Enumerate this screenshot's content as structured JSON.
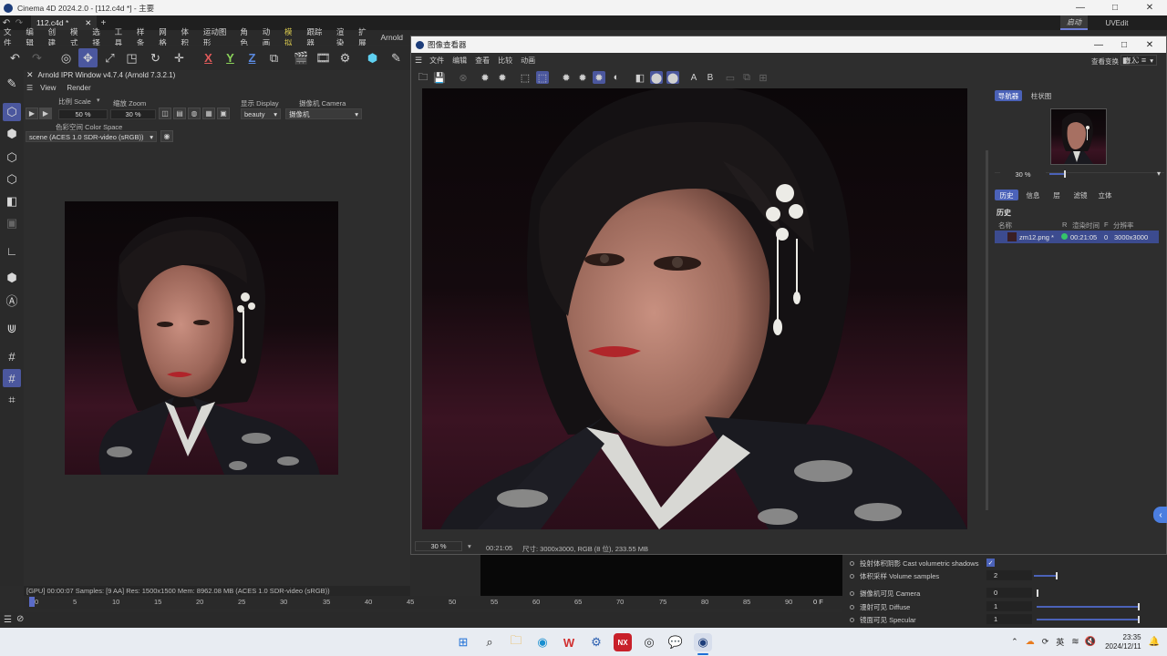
{
  "window": {
    "title": "Cinema 4D 2024.2.0 - [112.c4d *] - 主要",
    "min": "—",
    "max": "□",
    "close": "✕"
  },
  "tabs": {
    "doc_tab": "112.c4d *",
    "close": "✕",
    "add": "+",
    "layout_active": "启动",
    "layout_other": "UVEdit"
  },
  "menu": [
    "文件",
    "编辑",
    "创建",
    "模式",
    "选择",
    "工具",
    "样条",
    "网格",
    "体积",
    "运动图形",
    "角色",
    "动画",
    "模拟",
    "跟踪器",
    "渲染",
    "扩展",
    "Arnold"
  ],
  "axes": {
    "x": "X",
    "y": "Y",
    "z": "Z"
  },
  "ipr": {
    "title": "Arnold IPR Window v4.7.4 (Arnold 7.3.2.1)",
    "menu_view": "View",
    "menu_render": "Render",
    "scale_label": "比例 Scale",
    "scale_value": "50 %",
    "zoom_label": "缩放 Zoom",
    "zoom_value": "30 %",
    "display_label": "显示 Display",
    "display_value": "beauty",
    "camera_label": "摄像机 Camera",
    "camera_value": "摄像机",
    "colorspace_label": "色彩空间 Color Space",
    "colorspace_value": "scene (ACES 1.0 SDR-video (sRGB))"
  },
  "status": "[GPU] 00:00:07  Samples: [9 AA]  Res: 1500x1500  Mem: 8962.08 MB  (ACES 1.0 SDR-video (sRGB))",
  "timeline": {
    "ticks": [
      "0",
      "5",
      "10",
      "15",
      "20",
      "25",
      "30",
      "35",
      "40",
      "45",
      "50",
      "55",
      "60",
      "65",
      "70",
      "75",
      "80",
      "85",
      "90"
    ],
    "frame": "0 F"
  },
  "viewer": {
    "title": "图像查看器",
    "menu": [
      "文件",
      "编辑",
      "查看",
      "比较",
      "动画"
    ],
    "transform_label": "查看变换",
    "transform_value": "嵌入",
    "letters": [
      "A",
      "B"
    ],
    "zoom": "30 %",
    "time": "00:21:05",
    "info": "尺寸: 3000x3000, RGB (8 位), 233.55 MB",
    "side_tabs_top": [
      "导航器",
      "柱状图"
    ],
    "nav_zoom": "30 %",
    "side_tabs": [
      "历史",
      "信息",
      "层",
      "滤镜",
      "立体"
    ],
    "history_title": "历史",
    "history_cols": [
      "名称",
      "R",
      "渲染时间",
      "F",
      "分辨率"
    ],
    "history_row": {
      "name": "zm12.png *",
      "time": "00:21:05",
      "f": "0",
      "res": "3000x3000"
    }
  },
  "attributes": [
    {
      "label": "投射体积阴影 Cast volumetric shadows",
      "value": "✓"
    },
    {
      "label": "体积采样 Volume samples",
      "value": "2"
    },
    {
      "label": "摄像机可见 Camera",
      "value": "0"
    },
    {
      "label": "漫射可见 Diffuse",
      "value": "1"
    },
    {
      "label": "镜面可见 Specular",
      "value": "1"
    }
  ],
  "taskbar": {
    "ime": "英",
    "time": "23:35",
    "date": "2024/12/11"
  },
  "colors": {
    "accent": "#4b579e",
    "tab_accent": "#4b62b8",
    "green": "#35c46a"
  }
}
